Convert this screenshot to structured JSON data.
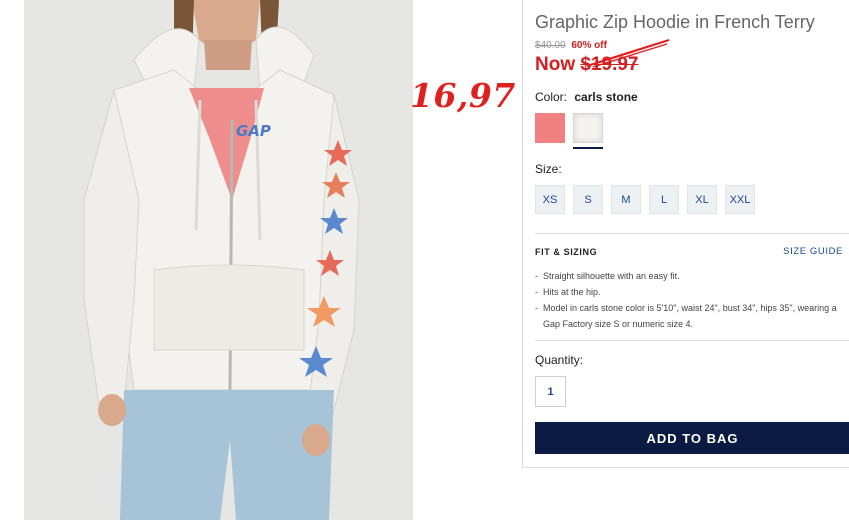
{
  "product": {
    "title": "Graphic Zip Hoodie in French Terry",
    "original_price": "$40.00",
    "discount": "60% off",
    "now_prefix": "Now",
    "sale_price": "$19.97",
    "image_logo_text": "GAP"
  },
  "annotation": {
    "handwritten_price": "16,97",
    "color": "#e21f1f"
  },
  "color": {
    "label": "Color:",
    "selected": "carls stone",
    "swatches": [
      {
        "name": "salmon",
        "hex": "#f18080"
      },
      {
        "name": "carls stone",
        "hex": "#f3f2ee"
      }
    ]
  },
  "size": {
    "label": "Size:",
    "options": [
      "XS",
      "S",
      "M",
      "L",
      "XL",
      "XXL"
    ]
  },
  "fit": {
    "heading": "FIT & SIZING",
    "guide_link": "SIZE GUIDE",
    "bullets": [
      "Straight silhouette with an easy fit.",
      "Hits at the hip.",
      "Model in carls stone color is 5'10\", waist 24\", bust 34\", hips 35\", wearing a Gap Factory size S or numeric size 4."
    ]
  },
  "quantity": {
    "label": "Quantity:",
    "value": "1"
  },
  "add_to_bag": "ADD TO BAG",
  "colors": {
    "navy": "#0b1a43",
    "sale_red": "#d31f1f",
    "link_blue": "#1c4a8c"
  }
}
